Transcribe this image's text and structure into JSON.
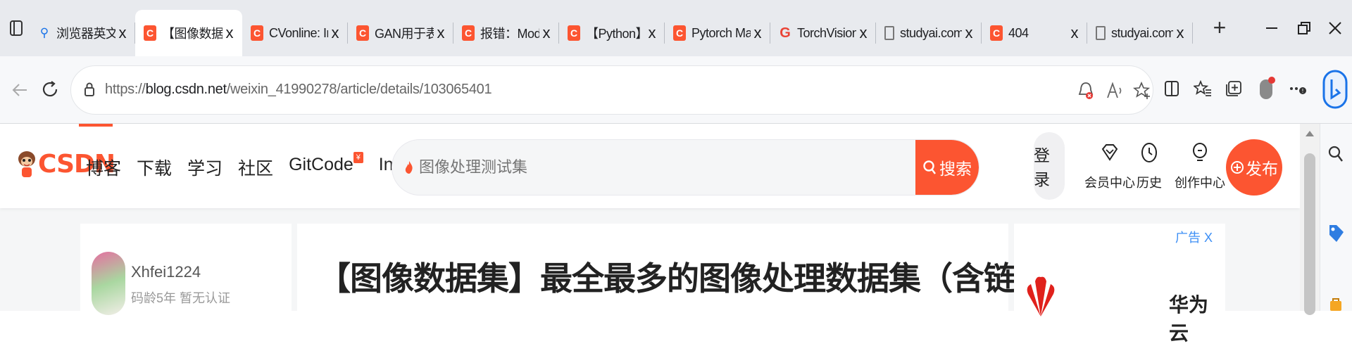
{
  "browser": {
    "tabs": [
      {
        "title": "浏览器英文 - 搜",
        "icon": "search-icon",
        "active": false
      },
      {
        "title": "【图像数据集】",
        "icon": "csdn-favicon",
        "active": true
      },
      {
        "title": "CVonline: Image",
        "icon": "csdn-favicon",
        "active": false
      },
      {
        "title": "GAN用于表面缺",
        "icon": "csdn-favicon",
        "active": false
      },
      {
        "title": "报错：ModuleN",
        "icon": "csdn-favicon",
        "active": false
      },
      {
        "title": "【Python】错误",
        "icon": "csdn-favicon",
        "active": false
      },
      {
        "title": "Pytorch Mask R",
        "icon": "csdn-favicon",
        "active": false
      },
      {
        "title": "TorchVision_Mas",
        "icon": "g-favicon",
        "active": false
      },
      {
        "title": "studyai.com",
        "icon": "document-icon",
        "active": false
      },
      {
        "title": "404",
        "icon": "csdn-favicon",
        "active": false
      },
      {
        "title": "studyai.com",
        "icon": "document-icon",
        "active": false
      }
    ],
    "tab_close": "x",
    "new_tab": "+",
    "url_prefix": "https://",
    "url_domain": "blog.csdn.net",
    "url_path": "/weixin_41990278/article/details/103065401"
  },
  "site": {
    "logo_text": "CSDN",
    "nav": [
      "博客",
      "下载",
      "学习",
      "社区",
      "GitCode",
      "InsCode"
    ],
    "gitcode_badge": "¥",
    "search_placeholder": "图像处理测试集",
    "search_button": "搜索",
    "login": "登录",
    "toolbox": [
      "会员中心",
      "历史",
      "创作中心"
    ],
    "publish": "发布"
  },
  "author": {
    "name": "Xhfei1224",
    "meta": "码龄5年  暂无认证"
  },
  "article": {
    "title": "【图像数据集】最全最多的图像处理数据集（含链接）"
  },
  "ad": {
    "label": "广告 X",
    "brand": "华为云"
  },
  "colors": {
    "accent": "#fc5531",
    "link_blue": "#3d8ff5"
  }
}
